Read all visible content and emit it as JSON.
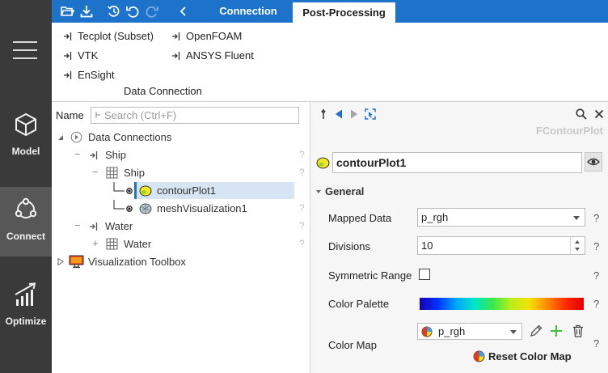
{
  "sidebar": {
    "items": [
      {
        "label": "Model",
        "icon": "cube-icon"
      },
      {
        "label": "Connect",
        "icon": "connect-icon",
        "active": true
      },
      {
        "label": "Optimize",
        "icon": "optimize-icon"
      }
    ]
  },
  "topbar": {
    "tabs": [
      {
        "label": "Connection"
      },
      {
        "label": "Post-Processing",
        "active": true
      }
    ],
    "accent": "#1d73c9"
  },
  "ribbon": {
    "items": [
      {
        "label": "Tecplot (Subset)"
      },
      {
        "label": "OpenFOAM"
      },
      {
        "label": "VTK"
      },
      {
        "label": "ANSYS Fluent"
      },
      {
        "label": "EnSight"
      }
    ],
    "group_label": "Data Connection"
  },
  "tree": {
    "name_label": "Name",
    "search_placeholder": "Search (Ctrl+F)",
    "nodes": [
      {
        "label": "Data Connections"
      },
      {
        "label": "Ship"
      },
      {
        "label": "Ship"
      },
      {
        "label": "contourPlot1",
        "selected": true
      },
      {
        "label": "meshVisualization1"
      },
      {
        "label": "Water"
      },
      {
        "label": "Water"
      },
      {
        "label": "Visualization Toolbox"
      }
    ],
    "help_mark": "?"
  },
  "properties": {
    "class_name": "FContourPlot",
    "object_name": "contourPlot1",
    "section": "General",
    "fields": {
      "mapped_data": {
        "label": "Mapped Data",
        "value": "p_rgh"
      },
      "divisions": {
        "label": "Divisions",
        "value": "10"
      },
      "symmetric_range": {
        "label": "Symmetric Range",
        "checked": false
      },
      "color_palette": {
        "label": "Color Palette"
      },
      "color_map": {
        "label": "Color Map",
        "value": "p_rgh"
      }
    },
    "reset_label": "Reset Color Map",
    "help_mark": "?"
  }
}
